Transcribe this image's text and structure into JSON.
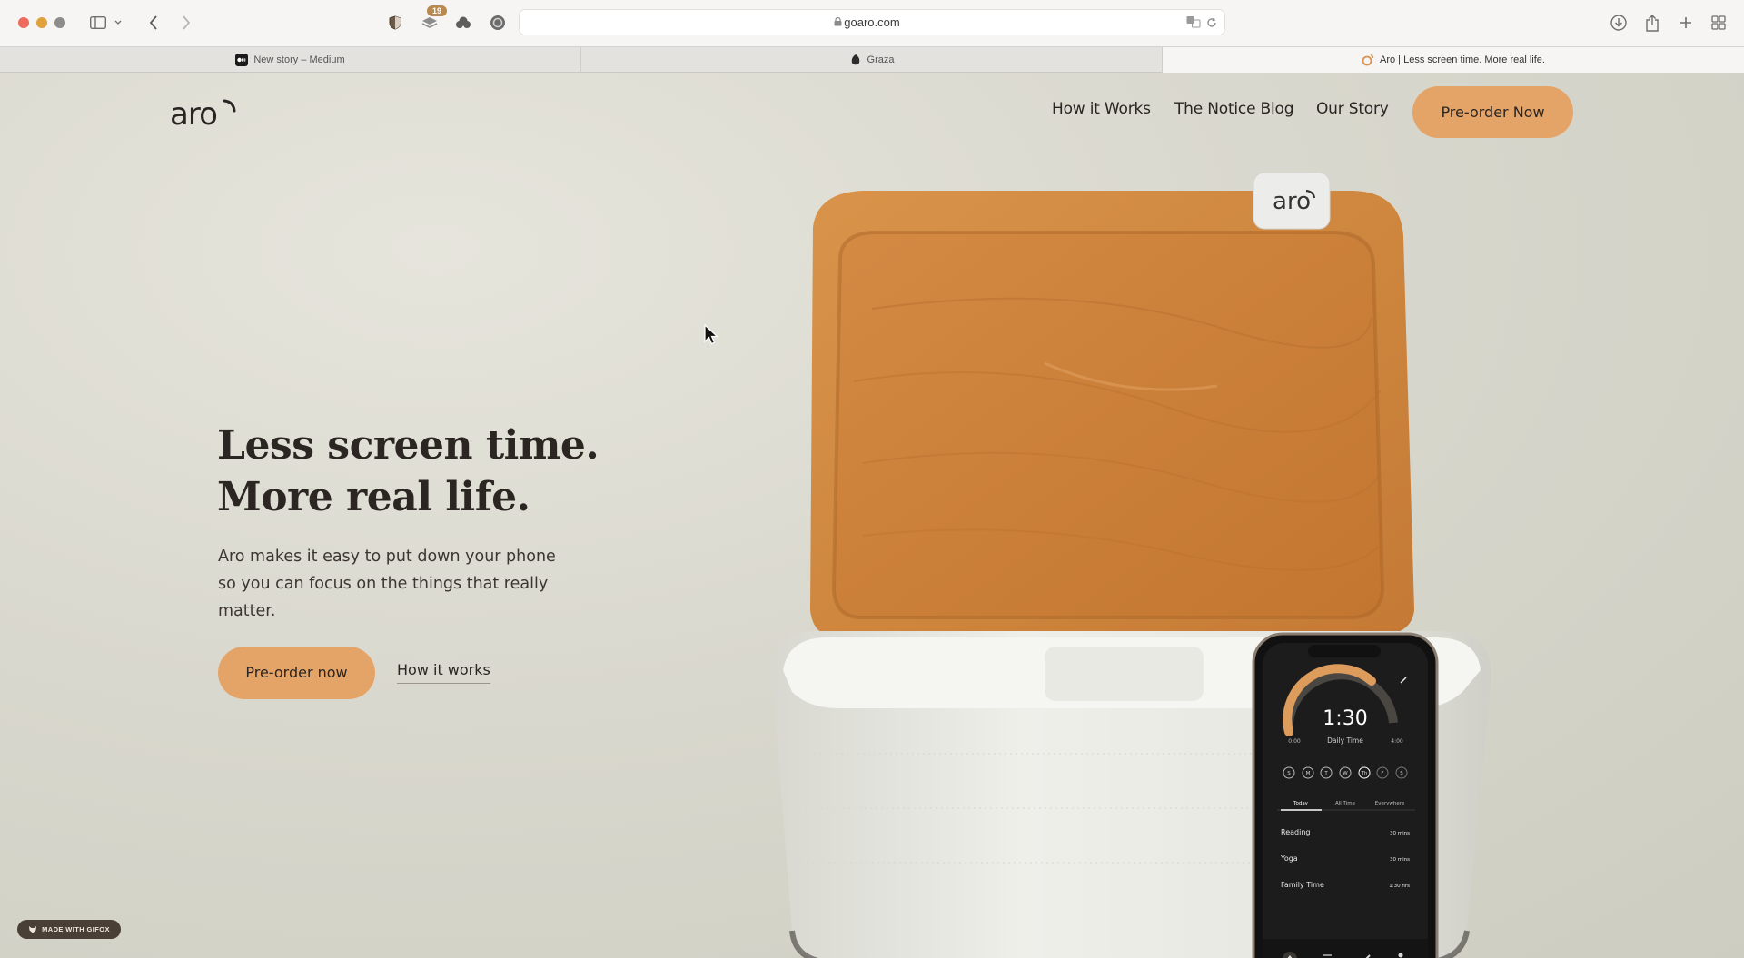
{
  "browser": {
    "url": "goaro.com",
    "extension_badge": "19",
    "tabs": [
      {
        "label": "New story – Medium",
        "active": false
      },
      {
        "label": "Graza",
        "active": false
      },
      {
        "label": "Aro | Less screen time. More real life.",
        "active": true
      }
    ]
  },
  "site": {
    "logo": "aro",
    "nav": {
      "links": [
        "How it Works",
        "The Notice Blog",
        "Our Story"
      ],
      "cta": "Pre-order Now"
    },
    "hero": {
      "headline_line1": "Less screen time.",
      "headline_line2": "More real life.",
      "subtext": "Aro makes it easy to put down your phone so you can focus on the things that really matter.",
      "primary_cta": "Pre-order now",
      "secondary_cta": "How it works"
    },
    "product_image": {
      "box_label": "aro",
      "phone": {
        "timer": "1:30",
        "timer_caption": "Daily Time",
        "range_start": "0:00",
        "range_end": "4:00",
        "days": [
          "S",
          "M",
          "T",
          "W",
          "Th",
          "F",
          "S"
        ],
        "tabs": [
          "Today",
          "All Time",
          "Everywhere"
        ],
        "activities": [
          {
            "name": "Reading",
            "time": "30 mins"
          },
          {
            "name": "Yoga",
            "time": "30 mins"
          },
          {
            "name": "Family Time",
            "time": "1:30 hrs"
          }
        ]
      }
    }
  },
  "overlay": {
    "gifox_badge": "MADE WITH GIFOX"
  },
  "colors": {
    "accent": "#e5a467",
    "text_dark": "#2a2522",
    "page_bg": "#d8d7cc"
  }
}
